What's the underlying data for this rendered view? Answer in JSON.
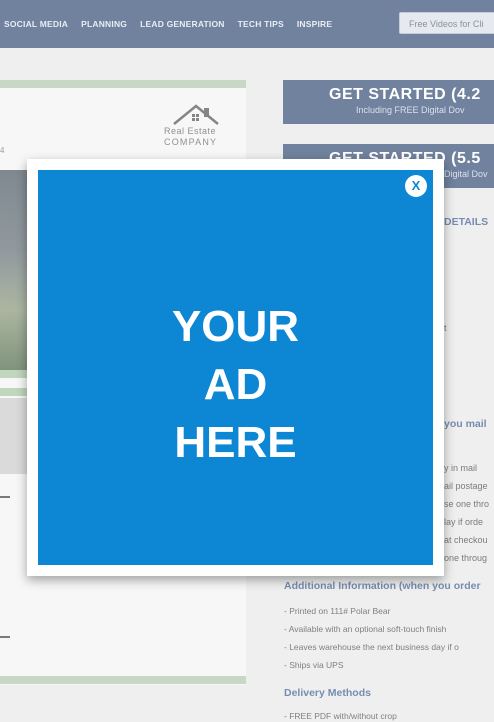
{
  "nav": {
    "items": [
      "SOCIAL MEDIA",
      "PLANNING",
      "LEAD GENERATION",
      "TECH TIPS",
      "INSPIRE"
    ],
    "video_button": "Free Videos for Cli"
  },
  "card": {
    "logo_title": "Real Estate",
    "logo_sub": "COMPANY",
    "number_fragment": "4"
  },
  "right": {
    "cta1_title": "GET STARTED (4.2",
    "cta1_sub": "Including FREE Digital Dov",
    "cta2_title": "GET STARTED (5.5",
    "cta2_sub": "Digital Dov",
    "details": "DETAILS",
    "fragment_t": "t",
    "mail_heading": "you mail",
    "mail_lines": [
      "y in mail",
      "ail postage",
      "se one thro",
      "lay if orde",
      "at checkou",
      "one throug"
    ],
    "additional_heading": "Additional Information (when you order",
    "additional_items": [
      "- Printed on 111# Polar Bear",
      "- Available with an optional soft-touch finish",
      "- Leaves warehouse the next business day if o",
      "- Ships via UPS"
    ],
    "delivery_heading": "Delivery Methods",
    "delivery_items": [
      "- FREE PDF with/without crop"
    ]
  },
  "modal": {
    "ad_line1": "YOUR",
    "ad_line2": "AD",
    "ad_line3": "HERE",
    "close_label": "X"
  },
  "colors": {
    "nav_bg": "#24406b",
    "ad_blue": "#0d86d4",
    "accent_green": "#a9c3a5",
    "heading_blue": "#2d4f86"
  }
}
